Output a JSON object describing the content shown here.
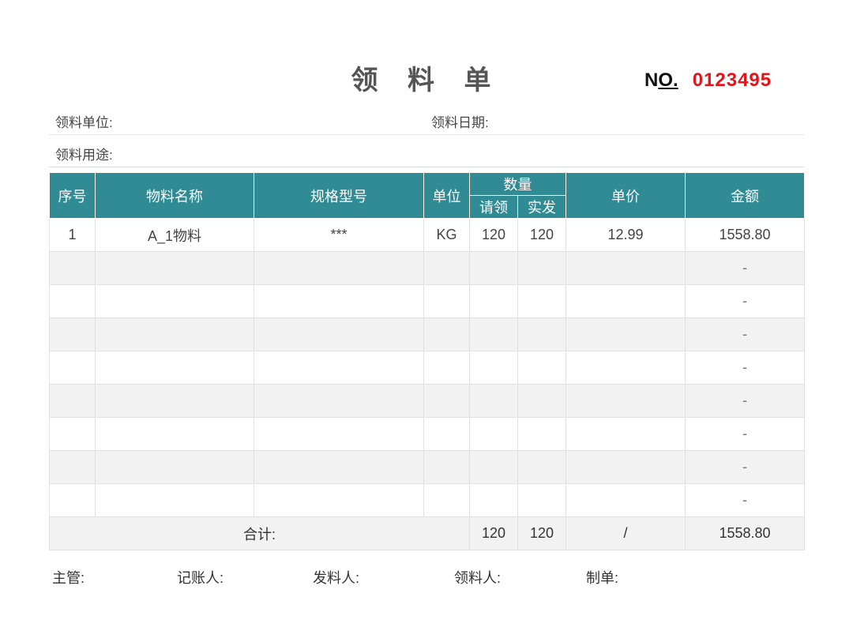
{
  "title": "领 料 单",
  "serial": {
    "label_n": "N",
    "label_o": "O.",
    "value": "0123495"
  },
  "info": {
    "dept_label": "领料单位:",
    "date_label": "领料日期:",
    "purpose_label": "领料用途:"
  },
  "table": {
    "headers": {
      "seq": "序号",
      "name": "物料名称",
      "spec": "规格型号",
      "unit": "单位",
      "qty": "数量",
      "req": "请领",
      "issued": "实发",
      "price": "单价",
      "amount": "金额"
    },
    "rows": [
      {
        "seq": "1",
        "name": "A_1物料",
        "spec": "***",
        "unit": "KG",
        "req": "120",
        "issued": "120",
        "price": "12.99",
        "amount": "1558.80"
      },
      {
        "seq": "",
        "name": "",
        "spec": "",
        "unit": "",
        "req": "",
        "issued": "",
        "price": "",
        "amount": "-"
      },
      {
        "seq": "",
        "name": "",
        "spec": "",
        "unit": "",
        "req": "",
        "issued": "",
        "price": "",
        "amount": "-"
      },
      {
        "seq": "",
        "name": "",
        "spec": "",
        "unit": "",
        "req": "",
        "issued": "",
        "price": "",
        "amount": "-"
      },
      {
        "seq": "",
        "name": "",
        "spec": "",
        "unit": "",
        "req": "",
        "issued": "",
        "price": "",
        "amount": "-"
      },
      {
        "seq": "",
        "name": "",
        "spec": "",
        "unit": "",
        "req": "",
        "issued": "",
        "price": "",
        "amount": "-"
      },
      {
        "seq": "",
        "name": "",
        "spec": "",
        "unit": "",
        "req": "",
        "issued": "",
        "price": "",
        "amount": "-"
      },
      {
        "seq": "",
        "name": "",
        "spec": "",
        "unit": "",
        "req": "",
        "issued": "",
        "price": "",
        "amount": "-"
      },
      {
        "seq": "",
        "name": "",
        "spec": "",
        "unit": "",
        "req": "",
        "issued": "",
        "price": "",
        "amount": "-"
      }
    ],
    "total": {
      "label": "合计:",
      "req": "120",
      "issued": "120",
      "price": "/",
      "amount": "1558.80"
    }
  },
  "footer": {
    "supervisor": "主管:",
    "bookkeeper": "记账人:",
    "issuer": "发料人:",
    "receiver": "领料人:",
    "preparer": "制单:"
  },
  "colors": {
    "header_bg": "#318b94",
    "serial_red": "#e0161b",
    "shade_row": "#f2f2f2"
  }
}
